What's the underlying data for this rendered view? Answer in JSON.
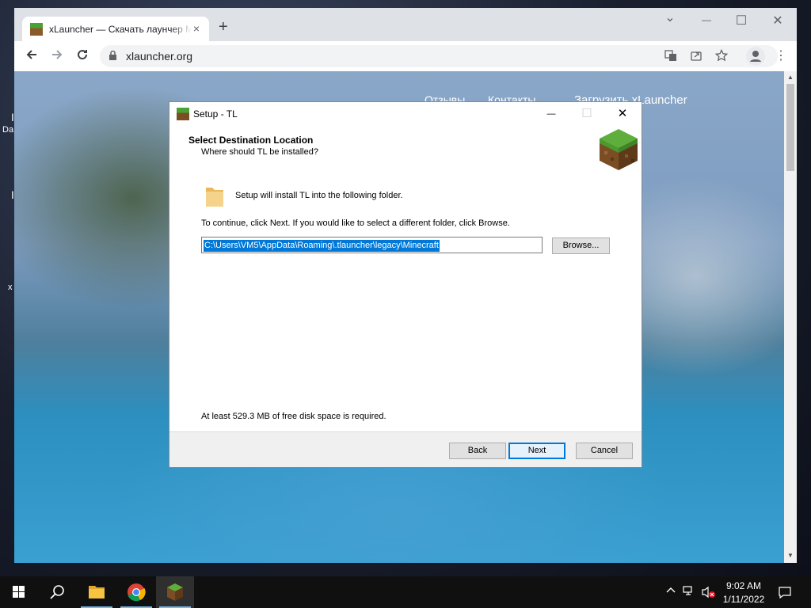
{
  "desktop": {
    "fragments": [
      "I",
      "Da",
      "I",
      "x"
    ]
  },
  "browser": {
    "tab": {
      "title": "xLauncher — Скачать лаунчер Майнкрафт",
      "favicon": "grass-block-icon",
      "close": "×"
    },
    "new_tab": "+",
    "window_controls": {
      "minimize": "—",
      "maximize": "☐",
      "close": "✕",
      "tab_search": "⌄"
    },
    "url": "xlauncher.org",
    "page_nav": [
      "Отзывы",
      "Контакты",
      "Загрузить xLauncher"
    ]
  },
  "dialog": {
    "title": "Setup - TL",
    "controls": {
      "minimize": "—",
      "maximize": "☐",
      "close": "✕"
    },
    "header_title": "Select Destination Location",
    "header_subtitle": "Where should TL be installed?",
    "install_text": "Setup will install TL into the following folder.",
    "continue_text": "To continue, click Next. If you would like to select a different folder, click Browse.",
    "path_value": "C:\\Users\\VM5\\AppData\\Roaming\\.tlauncher\\legacy\\Minecraft",
    "browse_label": "Browse...",
    "disk_space_text": "At least 529.3 MB of free disk space is required.",
    "back_label": "Back",
    "next_label": "Next",
    "cancel_label": "Cancel"
  },
  "taskbar": {
    "time": "9:02 AM",
    "date": "1/11/2022",
    "apps": [
      "start-icon",
      "search-icon",
      "file-explorer-icon",
      "chrome-icon",
      "tlauncher-icon"
    ]
  },
  "colors": {
    "selection": "#0078d7",
    "taskbar": "#101010",
    "chrome_frame": "#dee1e6"
  }
}
